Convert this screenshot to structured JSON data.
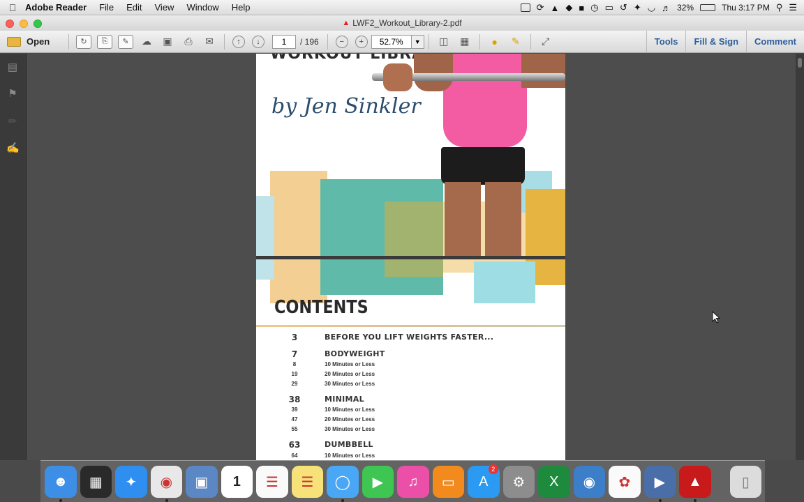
{
  "menubar": {
    "app_name": "Adobe Reader",
    "menus": [
      "File",
      "Edit",
      "View",
      "Window",
      "Help"
    ],
    "battery": "32%",
    "clock": "Thu 3:17 PM"
  },
  "window": {
    "title": "LWF2_Workout_Library-2.pdf"
  },
  "toolbar": {
    "open_label": "Open",
    "page_value": "1",
    "page_total": "/ 196",
    "zoom_value": "52.7%",
    "tools_label": "Tools",
    "fill_sign_label": "Fill & Sign",
    "comment_label": "Comment"
  },
  "document": {
    "cover_title": "WORKOUT LIBRARY",
    "byline": "by Jen Sinkler",
    "contents_heading": "CONTENTS",
    "toc": [
      {
        "page": "3",
        "title": "BEFORE YOU LIFT WEIGHTS FASTER...",
        "subs": []
      },
      {
        "page": "7",
        "title": "BODYWEIGHT",
        "subs": [
          {
            "page": "8",
            "title": "10 Minutes or Less"
          },
          {
            "page": "19",
            "title": "20 Minutes or Less"
          },
          {
            "page": "29",
            "title": "30 Minutes or Less"
          }
        ]
      },
      {
        "page": "38",
        "title": "MINIMAL",
        "subs": [
          {
            "page": "39",
            "title": "10 Minutes or Less"
          },
          {
            "page": "47",
            "title": "20 Minutes or Less"
          },
          {
            "page": "55",
            "title": "30 Minutes or Less"
          }
        ]
      },
      {
        "page": "63",
        "title": "DUMBBELL",
        "subs": [
          {
            "page": "64",
            "title": "10 Minutes or Less"
          }
        ]
      }
    ]
  },
  "dock": {
    "apps": [
      {
        "name": "Finder",
        "icon": "finder-icon",
        "color": "#3d8ee6"
      },
      {
        "name": "Mission Control",
        "icon": "mission-control-icon",
        "color": "#2a2a2a"
      },
      {
        "name": "Safari",
        "icon": "safari-icon",
        "color": "#2f8ff0"
      },
      {
        "name": "Chrome",
        "icon": "chrome-icon",
        "color": "#e8e8e8"
      },
      {
        "name": "Preview",
        "icon": "preview-icon",
        "color": "#5b87c4"
      },
      {
        "name": "Calendar",
        "icon": "calendar-icon",
        "color": "#ffffff"
      },
      {
        "name": "Reminders",
        "icon": "reminders-icon",
        "color": "#fafafa"
      },
      {
        "name": "Notes",
        "icon": "notes-icon",
        "color": "#f7e27a"
      },
      {
        "name": "Messages",
        "icon": "messages-icon",
        "color": "#4aa7f5"
      },
      {
        "name": "FaceTime",
        "icon": "facetime-icon",
        "color": "#3fc552"
      },
      {
        "name": "iTunes",
        "icon": "itunes-icon",
        "color": "#ec4fa8"
      },
      {
        "name": "iBooks",
        "icon": "ibooks-icon",
        "color": "#f28a1e"
      },
      {
        "name": "App Store",
        "icon": "app-store-icon",
        "color": "#2a9af2",
        "badge": "2"
      },
      {
        "name": "System Preferences",
        "icon": "system-preferences-icon",
        "color": "#8d8d8d"
      },
      {
        "name": "Excel",
        "icon": "excel-icon",
        "color": "#1e8a3e"
      },
      {
        "name": "Network Utility",
        "icon": "globe-icon",
        "color": "#3c7ec8"
      },
      {
        "name": "Photos",
        "icon": "photos-icon",
        "color": "#fafafa"
      },
      {
        "name": "Photo Slideshow",
        "icon": "clapper-icon",
        "color": "#4a6ea8"
      },
      {
        "name": "Adobe Reader",
        "icon": "adobe-reader-icon",
        "color": "#c8191b"
      },
      {
        "name": "Trash",
        "icon": "trash-icon",
        "color": "#dcdcdc"
      }
    ]
  }
}
